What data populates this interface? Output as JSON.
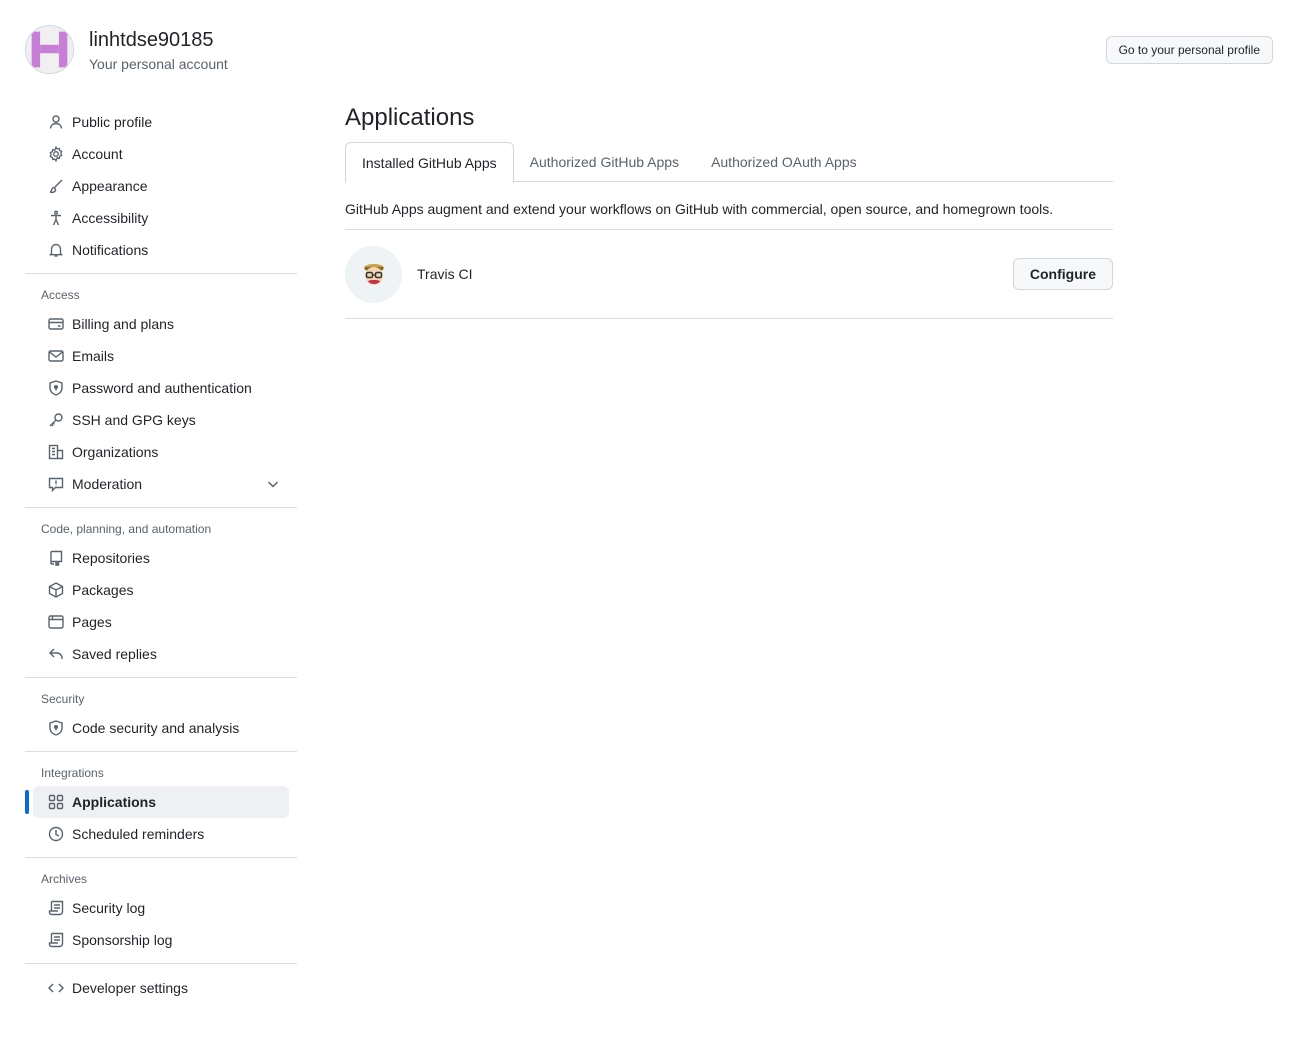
{
  "header": {
    "username": "linhtdse90185",
    "subtitle": "Your personal account",
    "profile_button": "Go to your personal profile"
  },
  "sidebar": {
    "top_items": [
      {
        "label": "Public profile",
        "icon": "person-icon"
      },
      {
        "label": "Account",
        "icon": "gear-icon"
      },
      {
        "label": "Appearance",
        "icon": "paintbrush-icon"
      },
      {
        "label": "Accessibility",
        "icon": "accessibility-icon"
      },
      {
        "label": "Notifications",
        "icon": "bell-icon"
      }
    ],
    "access": {
      "title": "Access",
      "items": [
        {
          "label": "Billing and plans",
          "icon": "credit-card-icon"
        },
        {
          "label": "Emails",
          "icon": "mail-icon"
        },
        {
          "label": "Password and authentication",
          "icon": "shield-lock-icon"
        },
        {
          "label": "SSH and GPG keys",
          "icon": "key-icon"
        },
        {
          "label": "Organizations",
          "icon": "organization-icon"
        },
        {
          "label": "Moderation",
          "icon": "report-icon"
        }
      ]
    },
    "code": {
      "title": "Code, planning, and automation",
      "items": [
        {
          "label": "Repositories",
          "icon": "repo-icon"
        },
        {
          "label": "Packages",
          "icon": "package-icon"
        },
        {
          "label": "Pages",
          "icon": "browser-icon"
        },
        {
          "label": "Saved replies",
          "icon": "reply-icon"
        }
      ]
    },
    "security": {
      "title": "Security",
      "items": [
        {
          "label": "Code security and analysis",
          "icon": "shield-lock-icon"
        }
      ]
    },
    "integrations": {
      "title": "Integrations",
      "items": [
        {
          "label": "Applications",
          "icon": "apps-icon",
          "active": true
        },
        {
          "label": "Scheduled reminders",
          "icon": "clock-icon"
        }
      ]
    },
    "archives": {
      "title": "Archives",
      "items": [
        {
          "label": "Security log",
          "icon": "log-icon"
        },
        {
          "label": "Sponsorship log",
          "icon": "log-icon"
        }
      ]
    },
    "developer": {
      "label": "Developer settings",
      "icon": "code-icon"
    }
  },
  "main": {
    "title": "Applications",
    "tabs": [
      {
        "label": "Installed GitHub Apps",
        "selected": true
      },
      {
        "label": "Authorized GitHub Apps"
      },
      {
        "label": "Authorized OAuth Apps"
      }
    ],
    "description": "GitHub Apps augment and extend your workflows on GitHub with commercial, open source, and homegrown tools.",
    "apps": [
      {
        "name": "Travis CI",
        "button": "Configure"
      }
    ]
  },
  "colors": {
    "accent": "#0969da",
    "avatar": "#c77ed6",
    "muted": "#59636e"
  }
}
